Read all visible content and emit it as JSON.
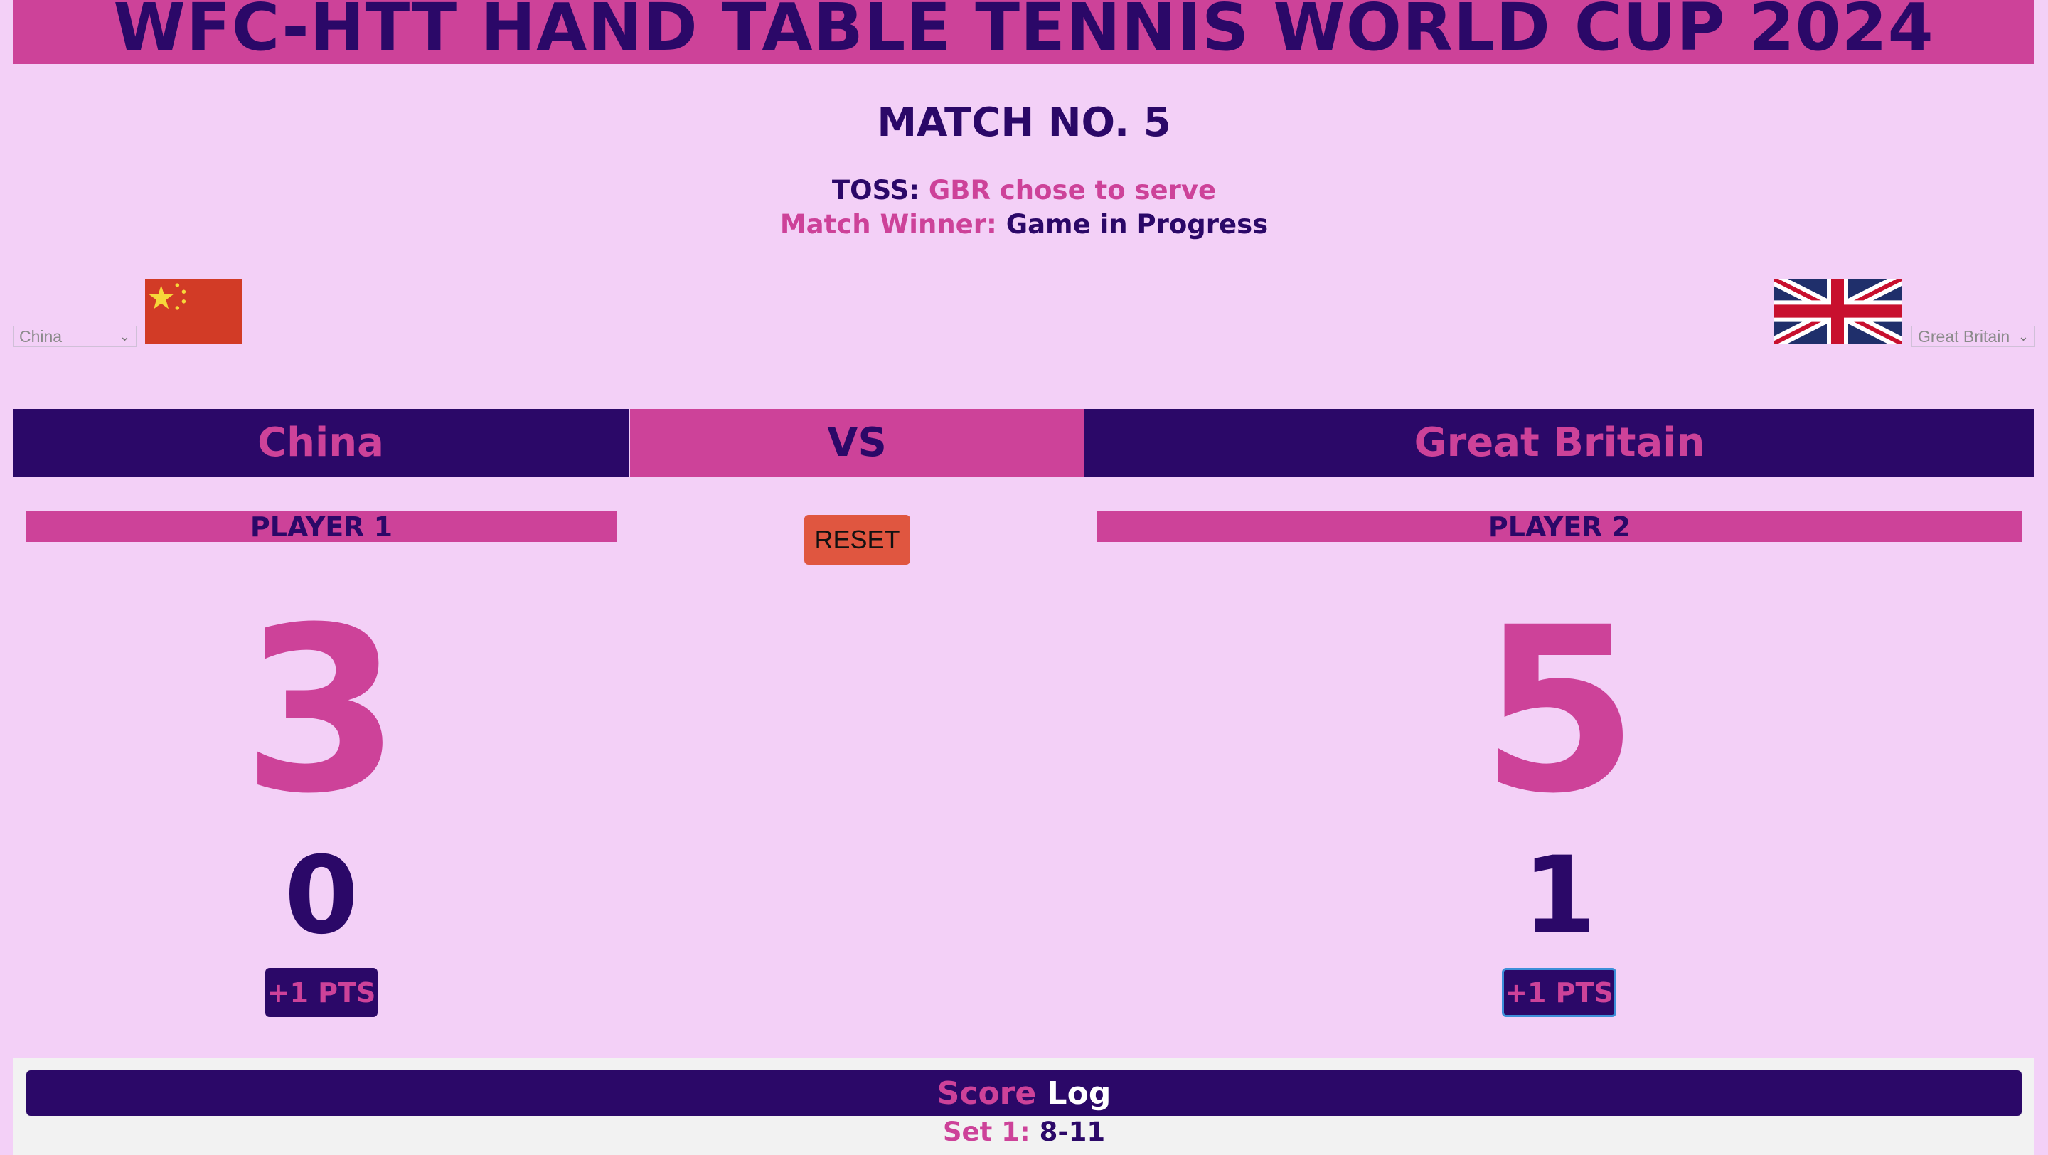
{
  "header": {
    "title": "WFC-HTT HAND TABLE TENNIS WORLD CUP 2024"
  },
  "match": {
    "number_label": "MATCH NO. 5",
    "toss_label": "TOSS:",
    "toss_value": "GBR chose to serve",
    "winner_label": "Match Winner:",
    "winner_value": "Game in Progress"
  },
  "team_selects": {
    "left": {
      "selected": "China"
    },
    "right": {
      "selected": "Great Britain"
    }
  },
  "flags": {
    "left": "china-flag",
    "right": "union-jack-flag"
  },
  "teams": {
    "left": "China",
    "vs": "VS",
    "right": "Great Britain"
  },
  "players": {
    "p1": {
      "label": "PLAYER 1",
      "points": "3",
      "sets": "0",
      "button": "+1 PTS"
    },
    "p2": {
      "label": "PLAYER 2",
      "points": "5",
      "sets": "1",
      "button": "+1 PTS"
    }
  },
  "controls": {
    "reset": "RESET"
  },
  "score_log": {
    "title_part1": "Score",
    "title_part2": "Log",
    "entries": [
      {
        "label": "Set 1:",
        "score": "8-11"
      }
    ]
  },
  "colors": {
    "navy": "#2b0868",
    "pink": "#cd4299",
    "background": "#f3d0f7",
    "reset": "#e05640"
  }
}
